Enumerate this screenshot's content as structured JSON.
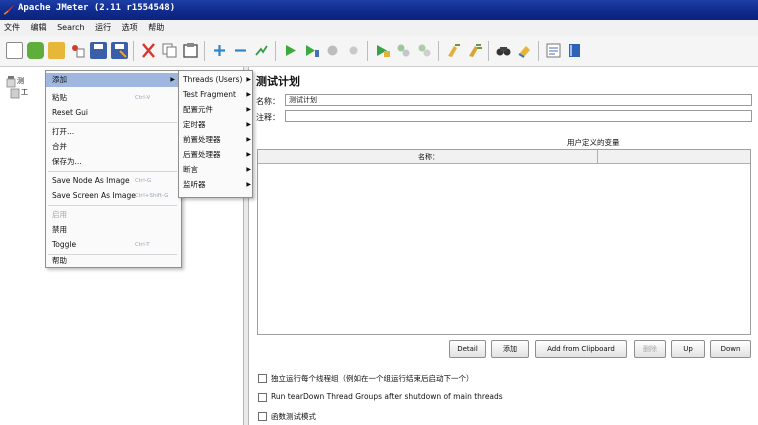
{
  "window": {
    "title": "Apache JMeter (2.11 r1554548)"
  },
  "menubar": [
    "文件",
    "编辑",
    "Search",
    "运行",
    "选项",
    "帮助"
  ],
  "tree": {
    "root_label": "测",
    "child_label": "工"
  },
  "context_menu": {
    "items": [
      {
        "label": "添加",
        "shortcut": "",
        "highlighted": true,
        "submenu": true
      },
      {
        "label": "粘贴",
        "shortcut": "Ctrl-V"
      },
      {
        "label": "Reset Gui",
        "shortcut": ""
      },
      {
        "label": "打开...",
        "shortcut": ""
      },
      {
        "label": "合并",
        "shortcut": ""
      },
      {
        "label": "保存为...",
        "shortcut": ""
      },
      {
        "label": "Save Node As Image",
        "shortcut": "Ctrl-G"
      },
      {
        "label": "Save Screen As Image",
        "shortcut": "Ctrl+Shift-G"
      },
      {
        "label": "启用",
        "shortcut": "",
        "disabled": true
      },
      {
        "label": "禁用",
        "shortcut": ""
      },
      {
        "label": "Toggle",
        "shortcut": "Ctrl-T"
      },
      {
        "label": "帮助",
        "shortcut": ""
      }
    ]
  },
  "submenu": {
    "items": [
      {
        "label": "Threads (Users)"
      },
      {
        "label": "Test Fragment"
      },
      {
        "label": "配置元件"
      },
      {
        "label": "定时器"
      },
      {
        "label": "前置处理器"
      },
      {
        "label": "后置处理器"
      },
      {
        "label": "断言"
      },
      {
        "label": "监听器"
      }
    ]
  },
  "panel": {
    "title": "测试计划",
    "name_label": "名称：",
    "name_value": "测试计划",
    "comment_label": "注释：",
    "variables_title": "用户定义的变量",
    "col_name": "名称："
  },
  "buttons": [
    {
      "label": "Detail",
      "disabled": false
    },
    {
      "label": "添加",
      "disabled": false
    },
    {
      "label": "Add from Clipboard",
      "disabled": false
    },
    {
      "label": "删除",
      "disabled": true
    },
    {
      "label": "Up",
      "disabled": false
    },
    {
      "label": "Down",
      "disabled": false
    }
  ],
  "options": [
    {
      "label": "独立运行每个线程组（例如在一个组运行结束后启动下一个）",
      "checked": false
    },
    {
      "label": "Run tearDown Thread Groups after shutdown of main threads",
      "checked": false
    },
    {
      "label": "函数测试模式",
      "checked": false
    }
  ],
  "colors": {
    "titlebar": "#1d3ea6",
    "highlight": "#9fb7de"
  }
}
